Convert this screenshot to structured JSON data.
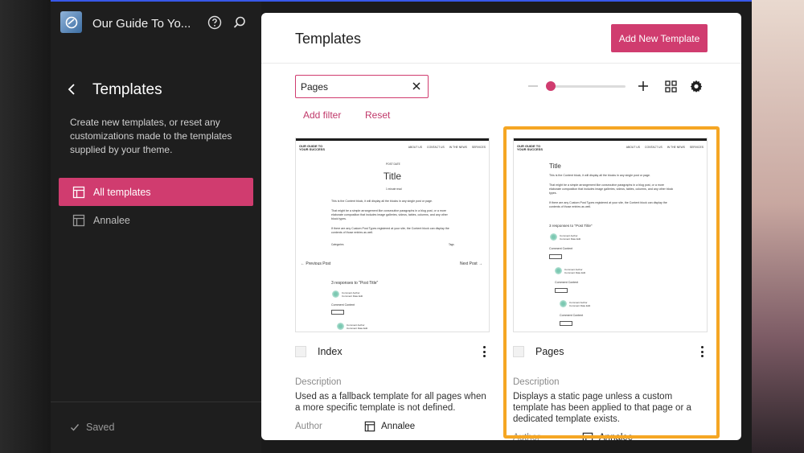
{
  "site": {
    "title": "Our Guide To Yo..."
  },
  "sidebar": {
    "title": "Templates",
    "description": "Create new templates, or reset any customizations made to the templates supplied by your theme.",
    "items": [
      {
        "label": "All templates"
      },
      {
        "label": "Annalee"
      }
    ],
    "status": "Saved"
  },
  "main": {
    "title": "Templates",
    "add_button": "Add New Template",
    "search": {
      "value": "Pages"
    },
    "add_filter": "Add filter",
    "reset": "Reset",
    "zoom_level": 0.05
  },
  "labels": {
    "description": "Description",
    "author": "Author"
  },
  "cards": [
    {
      "name": "Index",
      "description": "Used as a fallback template for all pages when a more specific template is not defined.",
      "author": "Annalee"
    },
    {
      "name": "Pages",
      "description": "Displays a static page unless a custom template has been applied to that page or a dedicated template exists.",
      "author": "Annalee"
    }
  ],
  "preview": {
    "brand": "OUR GUIDE TO YOUR SUCCESS",
    "nav": [
      "ABOUT US",
      "CONTACT US",
      "IN THE NEWS",
      "SERVICES"
    ],
    "post_date": "POST DATE",
    "title": "Title",
    "read_time": "1 minute read",
    "p1": "This is the Content block, it will display all the blocks in any single post or page.",
    "p2": "That might be a simple arrangement like consecutive paragraphs in a blog post, or a more elaborate composition that includes image galleries, videos, tables, columns, and any other block types.",
    "p3": "If there are any Custom Post Types registered at your site, the Content block can display the contents of those entries as well.",
    "categories": "Categories",
    "tags": "Tags",
    "prev": "Previous Post",
    "next": "Next Post",
    "responses": "3 responses to \"Post Title\"",
    "comment_author": "Comment Author",
    "comment_date": "Comment Date   Edit",
    "comment_content": "Comment Content",
    "reply": "REPLY"
  },
  "colors": {
    "accent": "#d03c6f",
    "highlight": "#f5a623",
    "sidebar_bg": "#1e1e1e"
  }
}
